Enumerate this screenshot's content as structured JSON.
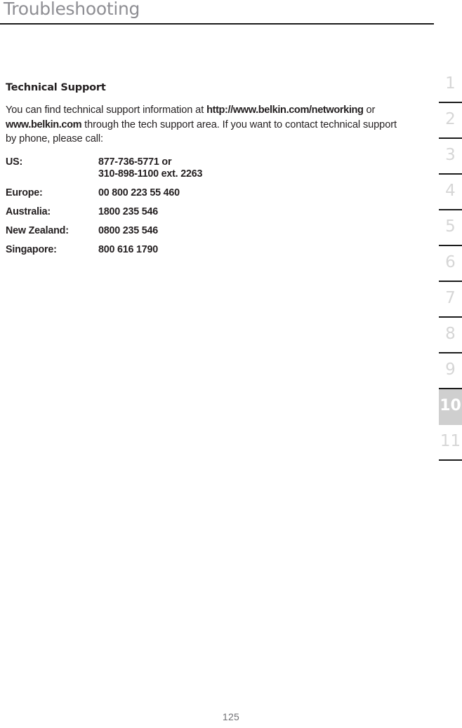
{
  "header": {
    "title": "Troubleshooting"
  },
  "main": {
    "section_heading": "Technical Support",
    "intro": {
      "part1": "You can find technical support information at ",
      "url1": "http://www.belkin.com/networking",
      "part2": " or ",
      "url2": "www.belkin.com",
      "part3": " through the tech support area. If you want to contact technical support by phone, please call:"
    },
    "support_rows": [
      {
        "region": "US:",
        "number": "877-736-5771 or\n310-898-1100 ext. 2263"
      },
      {
        "region": "Europe:",
        "number": "00 800 223 55 460"
      },
      {
        "region": "Australia:",
        "number": "1800 235 546"
      },
      {
        "region": "New Zealand:",
        "number": "0800 235 546"
      },
      {
        "region": "Singapore:",
        "number": "800 616 1790"
      }
    ]
  },
  "section_index": {
    "active_section": "10",
    "items": [
      {
        "label": "1",
        "active": false
      },
      {
        "label": "2",
        "active": false
      },
      {
        "label": "3",
        "active": false
      },
      {
        "label": "4",
        "active": false
      },
      {
        "label": "5",
        "active": false
      },
      {
        "label": "6",
        "active": false
      },
      {
        "label": "7",
        "active": false
      },
      {
        "label": "8",
        "active": false
      },
      {
        "label": "9",
        "active": false
      },
      {
        "label": "10",
        "active": true
      },
      {
        "label": "11",
        "active": false
      }
    ]
  },
  "footer": {
    "page_number": "125"
  },
  "colors": {
    "title_gray": "#8e8e93",
    "body_black": "#231f20",
    "rule_black": "#1b1b1b",
    "tab_number_gray": "#d6d6d6",
    "tab_active_background": "#cfcfcf",
    "page_number_gray": "#6f6f73"
  }
}
